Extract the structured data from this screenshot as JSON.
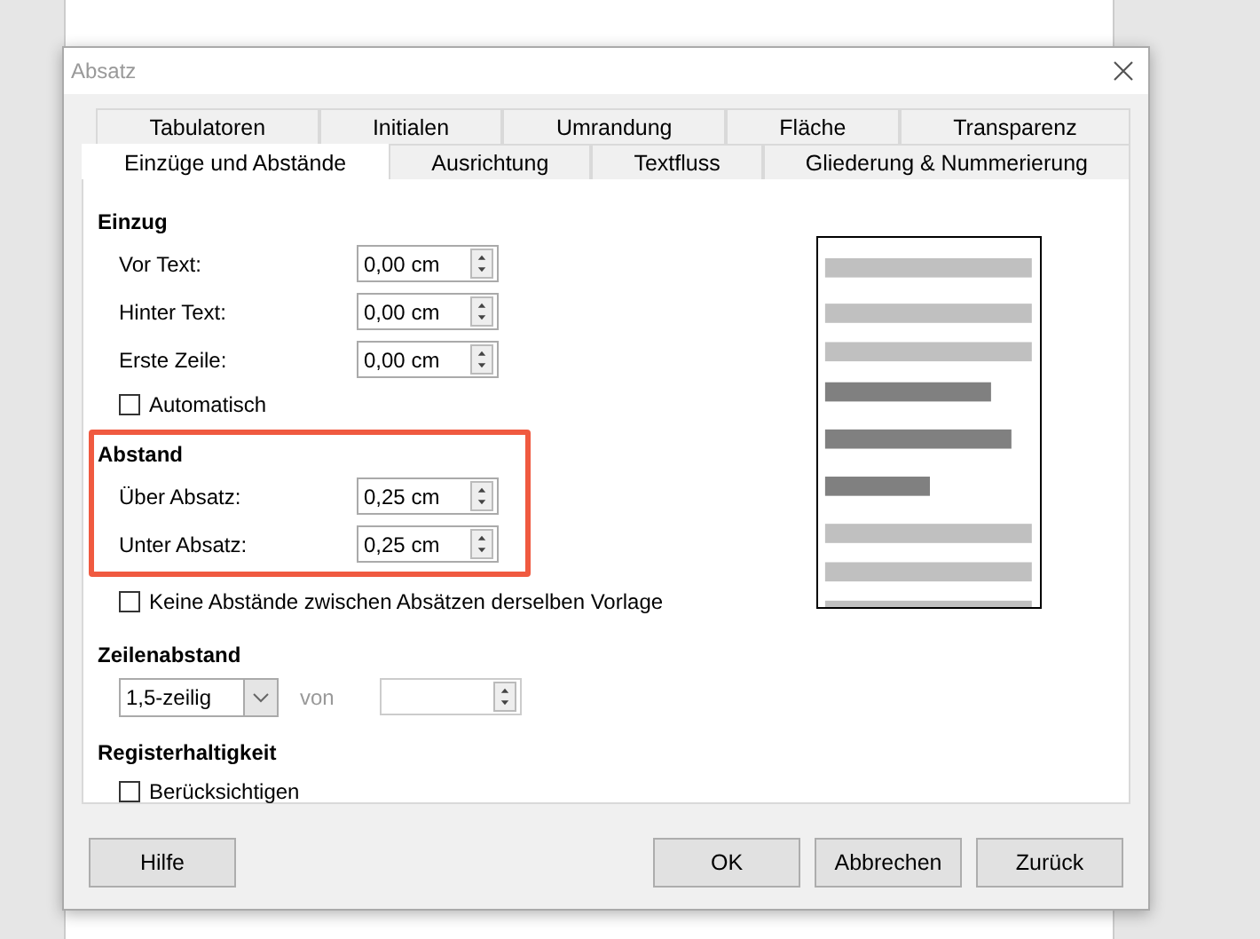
{
  "window": {
    "title": "Absatz"
  },
  "tab_rows": [
    [
      {
        "label": "Tabulatoren",
        "selected": false
      },
      {
        "label": "Initialen",
        "selected": false
      },
      {
        "label": "Umrandung",
        "selected": false
      },
      {
        "label": "Fläche",
        "selected": false
      },
      {
        "label": "Transparenz",
        "selected": false
      }
    ],
    [
      {
        "label": "Einzüge und Abstände",
        "selected": true
      },
      {
        "label": "Ausrichtung",
        "selected": false
      },
      {
        "label": "Textfluss",
        "selected": false
      },
      {
        "label": "Gliederung & Nummerierung",
        "selected": false
      }
    ]
  ],
  "sections": [
    {
      "title": "Einzug",
      "highlighted": false,
      "items": [
        {
          "kind": "spin",
          "label": "Vor Text:",
          "value": "0,00 cm"
        },
        {
          "kind": "spin",
          "label": "Hinter Text:",
          "value": "0,00 cm"
        },
        {
          "kind": "spin",
          "label": "Erste Zeile:",
          "value": "0,00 cm"
        },
        {
          "kind": "checkbox",
          "label": "Automatisch",
          "checked": false
        }
      ]
    },
    {
      "title": "Abstand",
      "highlighted": true,
      "items": [
        {
          "kind": "spin",
          "label": "Über Absatz:",
          "value": "0,25 cm"
        },
        {
          "kind": "spin",
          "label": "Unter Absatz:",
          "value": "0,25 cm"
        }
      ]
    },
    {
      "highlighted": false,
      "items": [
        {
          "kind": "checkbox",
          "label": "Keine Abstände zwischen Absätzen derselben Vorlage",
          "checked": false
        }
      ]
    },
    {
      "title": "Zeilenabstand",
      "highlighted": false,
      "items": [
        {
          "kind": "line-spacing",
          "value": "1,5-zeilig",
          "of_label": "von",
          "disabled": true
        }
      ]
    },
    {
      "title": "Registerhaltigkeit",
      "highlighted": false,
      "items": [
        {
          "kind": "checkbox",
          "label": "Berücksichtigen",
          "checked": false
        }
      ]
    }
  ],
  "buttons": [
    {
      "label": "Hilfe",
      "kind": "left"
    },
    {
      "label": "OK",
      "kind": "right"
    },
    {
      "label": "Abbrechen",
      "kind": "right"
    },
    {
      "label": "Zurück",
      "kind": "right"
    }
  ]
}
